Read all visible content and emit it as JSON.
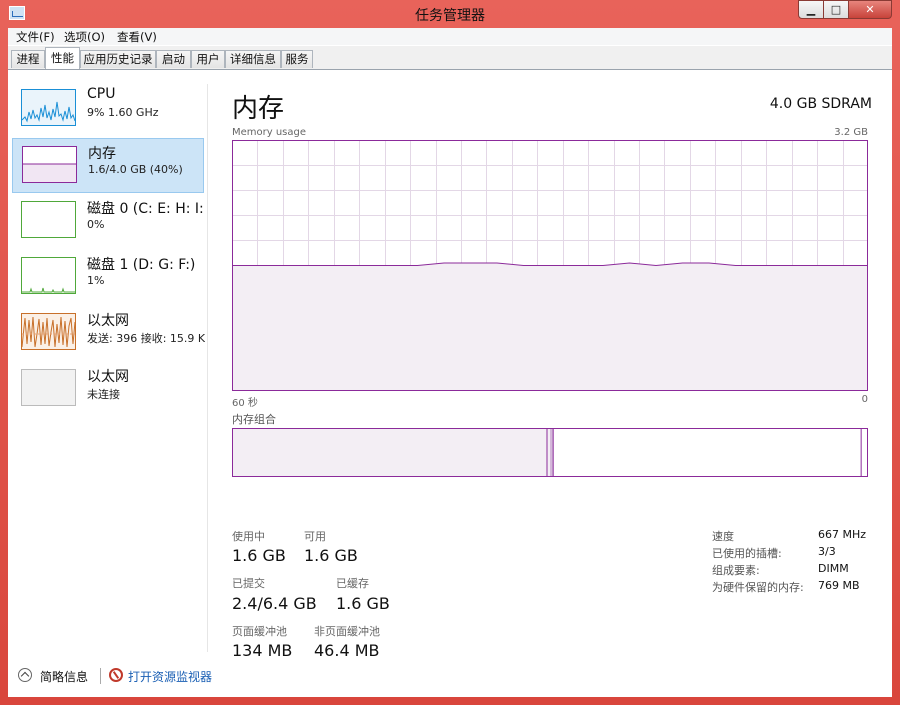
{
  "window": {
    "title": "任务管理器"
  },
  "menu": [
    "文件(F)",
    "选项(O)",
    "查看(V)"
  ],
  "tabs": [
    "进程",
    "性能",
    "应用历史记录",
    "启动",
    "用户",
    "详细信息",
    "服务"
  ],
  "active_tab": "性能",
  "sidebar": {
    "items": [
      {
        "title": "CPU",
        "sub": "9% 1.60 GHz",
        "color": "#1a8fd6",
        "selected": false
      },
      {
        "title": "内存",
        "sub": "1.6/4.0 GB (40%)",
        "color": "#8b2a9a",
        "selected": true
      },
      {
        "title": "磁盘 0 (C: E: H: I:",
        "sub": "0%",
        "color": "#4fa83a",
        "selected": false
      },
      {
        "title": "磁盘 1 (D: G: F:)",
        "sub": "1%",
        "color": "#4fa83a",
        "selected": false
      },
      {
        "title": "以太网",
        "sub": "发送: 396 接收: 15.9 K",
        "color": "#c8702a",
        "selected": false
      },
      {
        "title": "以太网",
        "sub": "未连接",
        "color": "#999999",
        "selected": false
      }
    ]
  },
  "memory": {
    "title": "内存",
    "spec": "4.0 GB SDRAM",
    "usage_label": "Memory usage",
    "max_label": "3.2 GB",
    "time_left": "60 秒",
    "time_right": "0",
    "composition_label": "内存组合",
    "usage_history_fraction": [
      0.5,
      0.5,
      0.5,
      0.5,
      0.5,
      0.5,
      0.5,
      0.5,
      0.51,
      0.51,
      0.51,
      0.5,
      0.5,
      0.5,
      0.5,
      0.51,
      0.5,
      0.51,
      0.51,
      0.5,
      0.5,
      0.5,
      0.5,
      0.5,
      0.5
    ],
    "composition": {
      "in_use": 0.5,
      "modified": 0.005,
      "standby": 0.485,
      "free": 0.01
    },
    "stats": {
      "in_use_label": "使用中",
      "in_use": "1.6 GB",
      "available_label": "可用",
      "available": "1.6 GB",
      "committed_label": "已提交",
      "committed": "2.4/6.4 GB",
      "cached_label": "已缓存",
      "cached": "1.6 GB",
      "paged_label": "页面缓冲池",
      "paged": "134 MB",
      "nonpaged_label": "非页面缓冲池",
      "nonpaged": "46.4 MB"
    },
    "hw": [
      {
        "k": "速度",
        "v": "667 MHz"
      },
      {
        "k": "已使用的插槽:",
        "v": "3/3"
      },
      {
        "k": "组成要素:",
        "v": "DIMM"
      },
      {
        "k": "为硬件保留的内存:",
        "v": "769 MB"
      }
    ]
  },
  "footer": {
    "fewer": "简略信息",
    "resmon": "打开资源监视器"
  },
  "colors": {
    "accent": "#8b2a9a",
    "fill": "#f3eef4",
    "grid": "#e3d7e6"
  }
}
